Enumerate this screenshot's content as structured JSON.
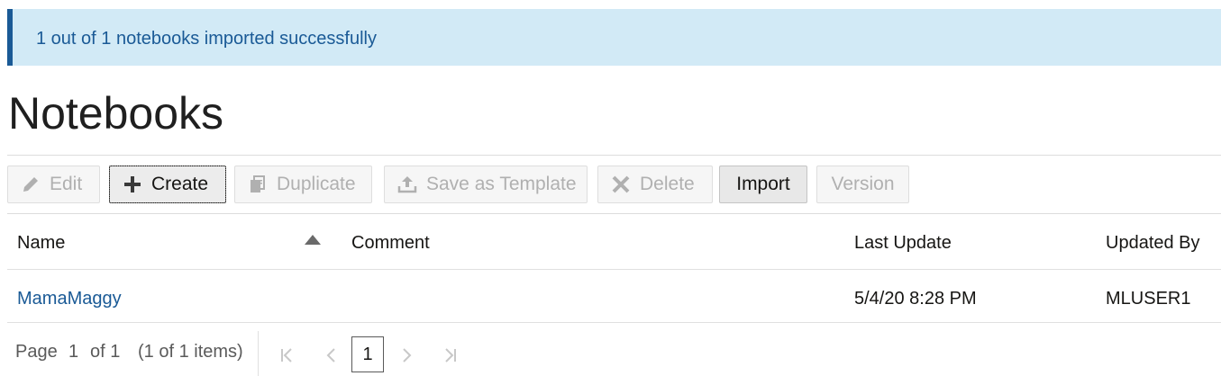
{
  "banner": {
    "message": "1 out of 1 notebooks imported successfully"
  },
  "page": {
    "title": "Notebooks"
  },
  "toolbar": {
    "edit": "Edit",
    "create": "Create",
    "duplicate": "Duplicate",
    "save_as_template": "Save as Template",
    "delete": "Delete",
    "import": "Import",
    "version": "Version"
  },
  "table": {
    "columns": {
      "name": "Name",
      "comment": "Comment",
      "last_update": "Last Update",
      "updated_by": "Updated By"
    },
    "rows": [
      {
        "name": "MamaMaggy",
        "comment": "",
        "last_update": "5/4/20 8:28 PM",
        "updated_by": "MLUSER1"
      }
    ]
  },
  "pager": {
    "page_label": "Page",
    "current": "1",
    "of_label": "of 1",
    "items": "(1 of 1 items)",
    "page_button": "1"
  },
  "colors": {
    "banner_bg": "#d2eaf6",
    "banner_accent": "#1a5a96",
    "link": "#1a5a96"
  }
}
